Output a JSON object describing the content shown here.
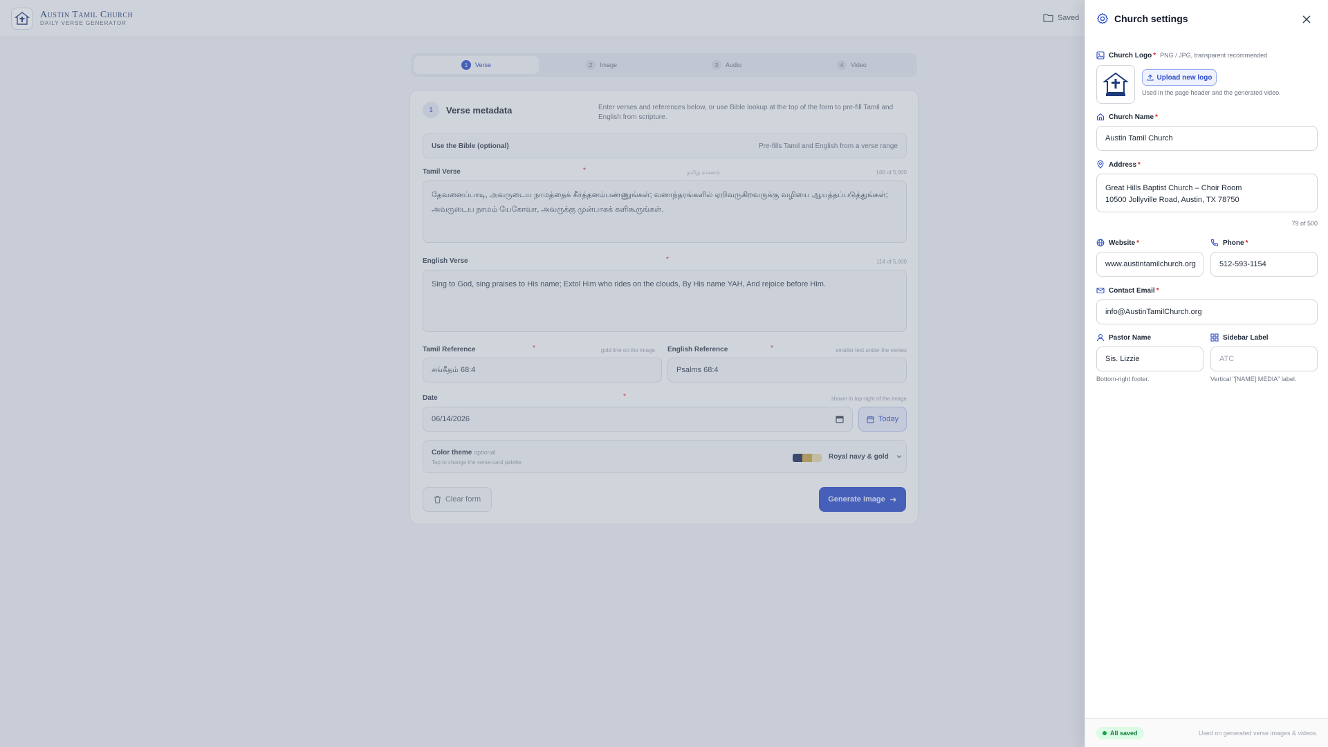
{
  "app": {
    "brand_title": "Austin Tamil Church",
    "brand_subtitle": "Daily Verse Generator",
    "saved_label": "Saved"
  },
  "steps": [
    {
      "num": "1",
      "label": "Verse"
    },
    {
      "num": "2",
      "label": "Image"
    },
    {
      "num": "3",
      "label": "Audio"
    },
    {
      "num": "4",
      "label": "Video"
    }
  ],
  "form": {
    "step_num": "1",
    "title": "Verse metadata",
    "description": "Enter verses and references below, or use Bible lookup at the top of the form to pre-fill Tamil and English from scripture.",
    "bible_label": "Use the Bible (optional)",
    "bible_hint": "Pre-fills Tamil and English from a verse range",
    "tamil_verse": {
      "label": "Tamil Verse",
      "required": "*",
      "center_hint": "தமிழ் வசனம்",
      "count": "166 of 5,000",
      "value": "தேவனைப்பாடி, அவருடைய நாமத்தைக் கீர்த்தனம்பண்ணுங்கள்; வனாந்தரங்களில் ஏறிவருகிறவருக்கு வழியை ஆயத்தப்படுத்துங்கள்; அவருடைய நாமம் யேகோவா, அவருக்கு முன்பாகக் களிகூருங்கள்."
    },
    "english_verse": {
      "label": "English Verse",
      "required": "*",
      "count": "114 of 5,000",
      "value": "Sing to God, sing praises to His name; Extol Him who rides on the clouds, By His name YAH, And rejoice before Him."
    },
    "tamil_ref": {
      "label": "Tamil Reference",
      "required": "*",
      "hint": "gold line on the image",
      "value": "சங்கீதம் 68:4"
    },
    "english_ref": {
      "label": "English Reference",
      "required": "*",
      "hint": "smaller text under the verses",
      "value": "Psalms 68:4"
    },
    "date": {
      "label": "Date",
      "required": "*",
      "hint": "shown in top-right of the image",
      "value": "06/14/2026",
      "today_label": "Today"
    },
    "theme": {
      "label": "Color theme",
      "optional": "optional",
      "sub": "Tap to change the verse-card palette",
      "name": "Royal navy & gold",
      "swatches": [
        "#1e2f5e",
        "#c7a548",
        "#e6d8a8"
      ]
    },
    "clear_label": "Clear form",
    "generate_label": "Generate image"
  },
  "settings": {
    "title": "Church settings",
    "logo": {
      "label": "Church Logo",
      "required": "*",
      "note": "PNG / JPG, transparent recommended",
      "upload_label": "Upload new logo",
      "help": "Used in the page header and the generated video."
    },
    "church_name": {
      "label": "Church Name",
      "required": "*",
      "value": "Austin Tamil Church"
    },
    "address": {
      "label": "Address",
      "required": "*",
      "line1": "Great Hills Baptist Church – Choir Room",
      "line2": "10500 Jollyville Road, Austin, TX 78750",
      "count": "79 of 500"
    },
    "website": {
      "label": "Website",
      "required": "*",
      "value": "www.austintamilchurch.org"
    },
    "phone": {
      "label": "Phone",
      "required": "*",
      "value": "512-593-1154"
    },
    "email": {
      "label": "Contact Email",
      "required": "*",
      "value": "info@AustinTamilChurch.org"
    },
    "pastor": {
      "label": "Pastor Name",
      "value": "Sis. Lizzie",
      "help": "Bottom-right footer."
    },
    "sidebar_label": {
      "label": "Sidebar Label",
      "placeholder": "ATC",
      "help": "Vertical \"[NAME] MEDIA\" label."
    },
    "footer_status": "All saved",
    "footer_note": "Used on generated verse images & videos."
  }
}
